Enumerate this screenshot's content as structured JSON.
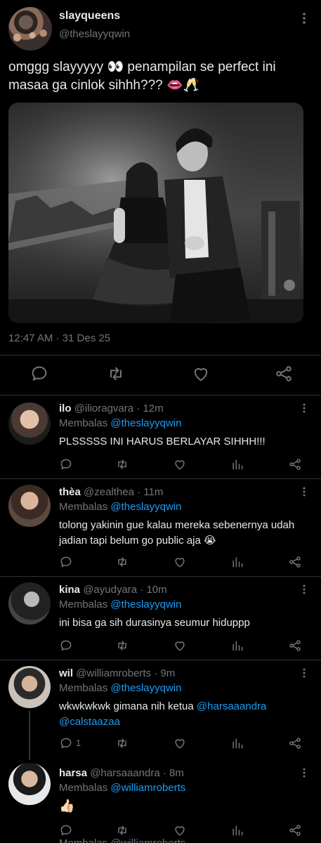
{
  "main_tweet": {
    "display_name": "slayqueens",
    "handle": "@theslayyqwin",
    "text": "omggg slayyyyy 👀 penampilan se perfect ini masaa ga cinlok sihhh??? 👄🥂",
    "timestamp": "12:47 AM · 31 Des 25",
    "actions": [
      "reply-icon",
      "retweet-icon",
      "like-icon",
      "share-icon"
    ]
  },
  "replies": [
    {
      "display_name": "ilo",
      "handle": "@ilioragvara",
      "time": "12m",
      "replying_prefix": "Membalas",
      "replying_to": "@theslayyqwin",
      "text": "PLSSSSS INI HARUS BERLAYAR SIHHH!!!",
      "reply_count": ""
    },
    {
      "display_name": "thèa",
      "handle": "@zealthea",
      "time": "11m",
      "replying_prefix": "Membalas",
      "replying_to": "@theslayyqwin",
      "text": "tolong yakinin gue kalau mereka sebenernya udah jadian tapi belum go public aja 😭",
      "reply_count": ""
    },
    {
      "display_name": "kina",
      "handle": "@ayudyara",
      "time": "10m",
      "replying_prefix": "Membalas",
      "replying_to": "@theslayyqwin",
      "text": "ini bisa ga sih durasinya seumur hiduppp",
      "reply_count": ""
    },
    {
      "display_name": "wil",
      "handle": "@williamroberts",
      "time": "9m",
      "replying_prefix": "Membalas",
      "replying_to": "@theslayyqwin",
      "text_prefix": "wkwkwkwk gimana nih ketua",
      "text_mention_1": "@harsaaandra",
      "text_mention_2": "@calstaazaa",
      "reply_count": "1"
    },
    {
      "display_name": "harsa",
      "handle": "@harsaaandra",
      "time": "8m",
      "replying_prefix": "Membalas",
      "replying_to": "@williamroberts",
      "text": "👍🏻",
      "reply_count": ""
    }
  ],
  "cutoff_text": "Membalas @williamroberts",
  "colors": {
    "background": "#000000",
    "text": "#e7e9ea",
    "muted": "#71767b",
    "accent": "#1d9bf0",
    "divider": "#2f3336"
  }
}
